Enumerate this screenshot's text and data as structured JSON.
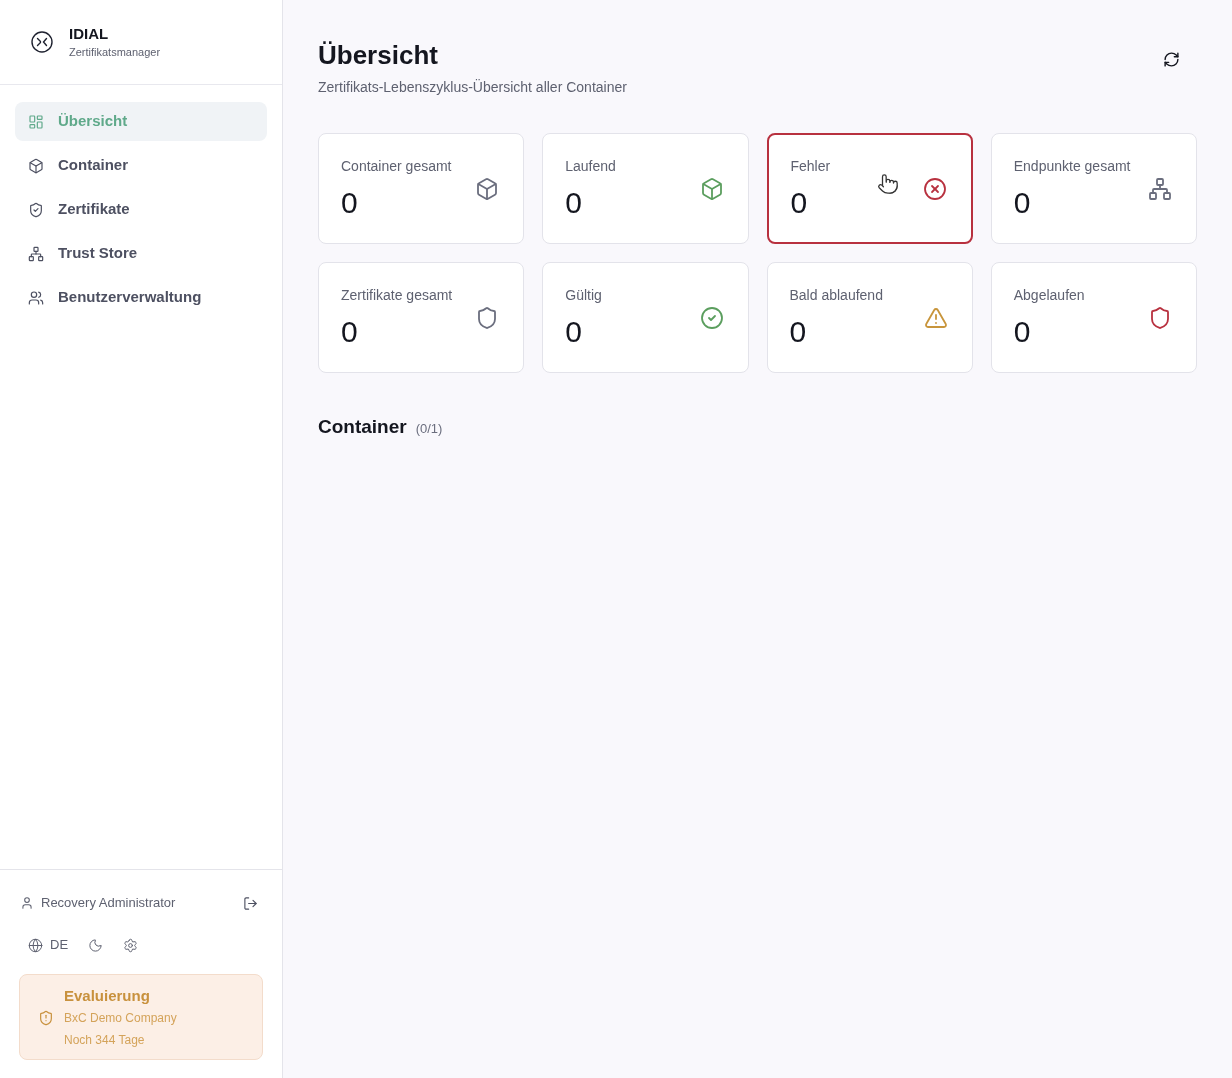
{
  "sidebar": {
    "brand": {
      "name": "IDIAL",
      "subtitle": "Zertifikatsmanager"
    },
    "nav": [
      {
        "label": "Übersicht",
        "kind": "overview",
        "selected": true
      },
      {
        "label": "Container",
        "kind": "containers",
        "selected": false
      },
      {
        "label": "Zertifikate",
        "kind": "certificates",
        "selected": false
      },
      {
        "label": "Trust Store",
        "kind": "truststore",
        "selected": false
      },
      {
        "label": "Benutzerverwaltung",
        "kind": "users",
        "selected": false
      }
    ],
    "user": {
      "name": "Recovery Administrator"
    },
    "language": "DE",
    "license": {
      "title": "Evaluierung",
      "company": "BxC Demo Company",
      "remaining": "Noch 344 Tage"
    }
  },
  "page": {
    "title": "Übersicht",
    "subtitle": "Zertifikats-Lebenszyklus-Übersicht aller Container"
  },
  "stats": [
    {
      "label": "Container gesamt",
      "value": "0",
      "kind": "containers",
      "hovered": false
    },
    {
      "label": "Laufend",
      "value": "0",
      "kind": "running",
      "hovered": false
    },
    {
      "label": "Fehler",
      "value": "0",
      "kind": "errors",
      "hovered": true
    },
    {
      "label": "Endpunkte gesamt",
      "value": "0",
      "kind": "endpoints",
      "hovered": false
    },
    {
      "label": "Zertifikate gesamt",
      "value": "0",
      "kind": "certificates",
      "hovered": false
    },
    {
      "label": "Gültig",
      "value": "0",
      "kind": "valid",
      "hovered": false
    },
    {
      "label": "Bald ablaufend",
      "value": "0",
      "kind": "expiring",
      "hovered": false
    },
    {
      "label": "Abgelaufen",
      "value": "0",
      "kind": "expired",
      "hovered": false
    }
  ],
  "section": {
    "title": "Container",
    "count": "(0/1)"
  }
}
